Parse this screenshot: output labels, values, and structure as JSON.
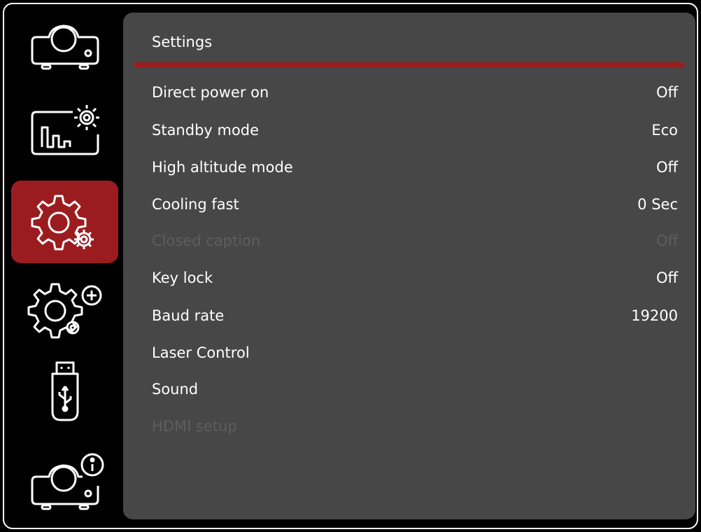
{
  "colors": {
    "accent": "#9b1c1f",
    "panel_bg": "#474747",
    "text": "#ffffff",
    "disabled_text": "#5e5e5e",
    "frame_bg": "#000000"
  },
  "sidebar": {
    "items": [
      {
        "icon": "projector-icon",
        "active": false
      },
      {
        "icon": "picture-settings-icon",
        "active": false
      },
      {
        "icon": "settings-gear-icon",
        "active": true
      },
      {
        "icon": "advanced-settings-icon",
        "active": false
      },
      {
        "icon": "usb-drive-icon",
        "active": false
      },
      {
        "icon": "projector-info-icon",
        "active": false
      }
    ]
  },
  "panel": {
    "title": "Settings",
    "rows": [
      {
        "label": "Direct power on",
        "value": "Off",
        "enabled": true
      },
      {
        "label": "Standby mode",
        "value": "Eco",
        "enabled": true
      },
      {
        "label": "High altitude mode",
        "value": "Off",
        "enabled": true
      },
      {
        "label": "Cooling fast",
        "value": "0 Sec",
        "enabled": true
      },
      {
        "label": "Closed caption",
        "value": "Off",
        "enabled": false
      },
      {
        "label": "Key lock",
        "value": "Off",
        "enabled": true
      },
      {
        "label": "Baud rate",
        "value": "19200",
        "enabled": true
      },
      {
        "label": "Laser Control",
        "value": "",
        "enabled": true
      },
      {
        "label": "Sound",
        "value": "",
        "enabled": true
      },
      {
        "label": "HDMI setup",
        "value": "",
        "enabled": false
      }
    ]
  }
}
